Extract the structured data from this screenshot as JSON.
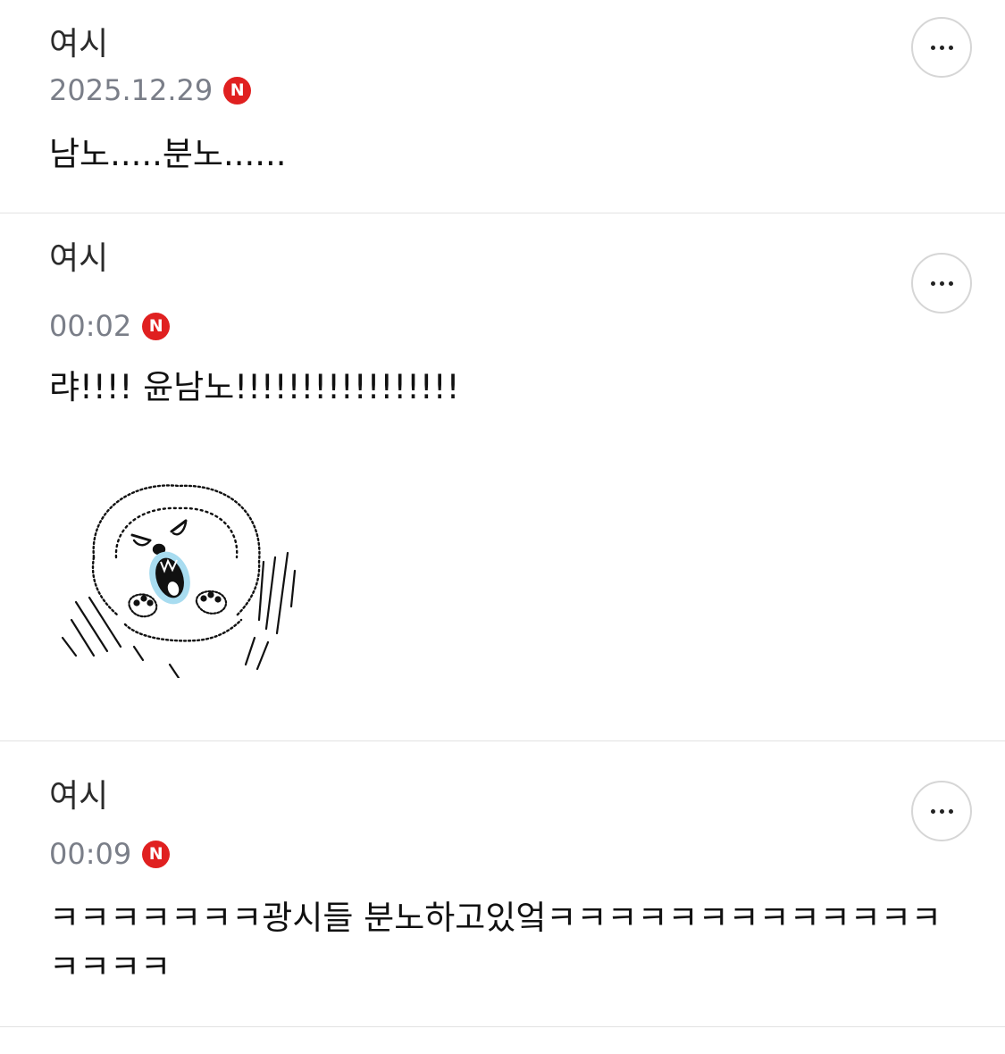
{
  "comments": [
    {
      "author": "여시",
      "time": "2025.12.29",
      "badge": "N",
      "text": "남노.....분노......"
    },
    {
      "author": "여시",
      "time": "00:02",
      "badge": "N",
      "text": "랴!!!! 윤남노!!!!!!!!!!!!!!!!!",
      "sticker": "angry-fluffy-dog-sticker"
    },
    {
      "author": "여시",
      "time": "00:09",
      "badge": "N",
      "text": "ㅋㅋㅋㅋㅋㅋㅋ광시들 분노하고있엌ㅋㅋㅋㅋㅋㅋㅋㅋㅋㅋㅋㅋㅋㅋㅋㅋㅋ"
    }
  ],
  "icons": {
    "more": "more-horizontal-icon",
    "new_badge": "new-badge-icon"
  },
  "colors": {
    "badge": "#e02020",
    "meta_text": "#7a7e88",
    "divider": "#e2e2e2",
    "sticker_mouth": "#a8dcf0"
  }
}
